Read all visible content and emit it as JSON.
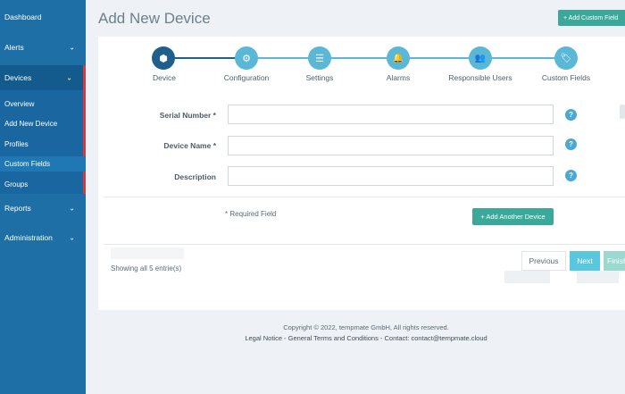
{
  "sidebar": {
    "items": [
      {
        "label": "Dashboard",
        "chevron": false
      },
      {
        "label": "Alerts",
        "chevron": true
      },
      {
        "label": "Devices",
        "chevron": true
      },
      {
        "label": "Reports",
        "chevron": true
      },
      {
        "label": "Administration",
        "chevron": true
      }
    ],
    "devices_submenu": [
      "Overview",
      "Add New Device",
      "Profiles",
      "Custom Fields",
      "Groups"
    ],
    "chevron_glyph": "⌄"
  },
  "header": {
    "title": "Add New Device",
    "custom_field_button": "+ Add Custom Field"
  },
  "stepper": {
    "steps": [
      {
        "label": "Device",
        "icon": "cube-icon",
        "glyph": "⬢",
        "active": true
      },
      {
        "label": "Configuration",
        "icon": "gears-icon",
        "glyph": "⚙",
        "active": false
      },
      {
        "label": "Settings",
        "icon": "sliders-icon",
        "glyph": "☰",
        "active": false
      },
      {
        "label": "Alarms",
        "icon": "bell-icon",
        "glyph": "🔔",
        "active": false
      },
      {
        "label": "Responsible Users",
        "icon": "users-icon",
        "glyph": "👥",
        "active": false
      },
      {
        "label": "Custom Fields",
        "icon": "tags-icon",
        "glyph": "🏷",
        "active": false
      }
    ]
  },
  "form": {
    "fields": [
      {
        "label": "Serial Number *",
        "value": ""
      },
      {
        "label": "Device Name *",
        "value": ""
      },
      {
        "label": "Description",
        "value": ""
      }
    ],
    "help_glyph": "?",
    "required_note": "* Required Field",
    "add_another_button": "+ Add Another Device"
  },
  "table": {
    "entries_text": "Showing all 5 entrie(s)"
  },
  "pager": {
    "previous": "Previous",
    "next": "Next",
    "finish": "Finish"
  },
  "footer": {
    "copyright": "Copyright © 2022, tempmate GmbH, All rights reserved.",
    "links": "Legal Notice - General Terms and Conditions - Contact: contact@tempmate.cloud"
  },
  "colors": {
    "sidebar": "#1d6fa5",
    "accent": "#3aa99a",
    "step": "#5ab8d6",
    "step_active": "#1e5f8c"
  }
}
